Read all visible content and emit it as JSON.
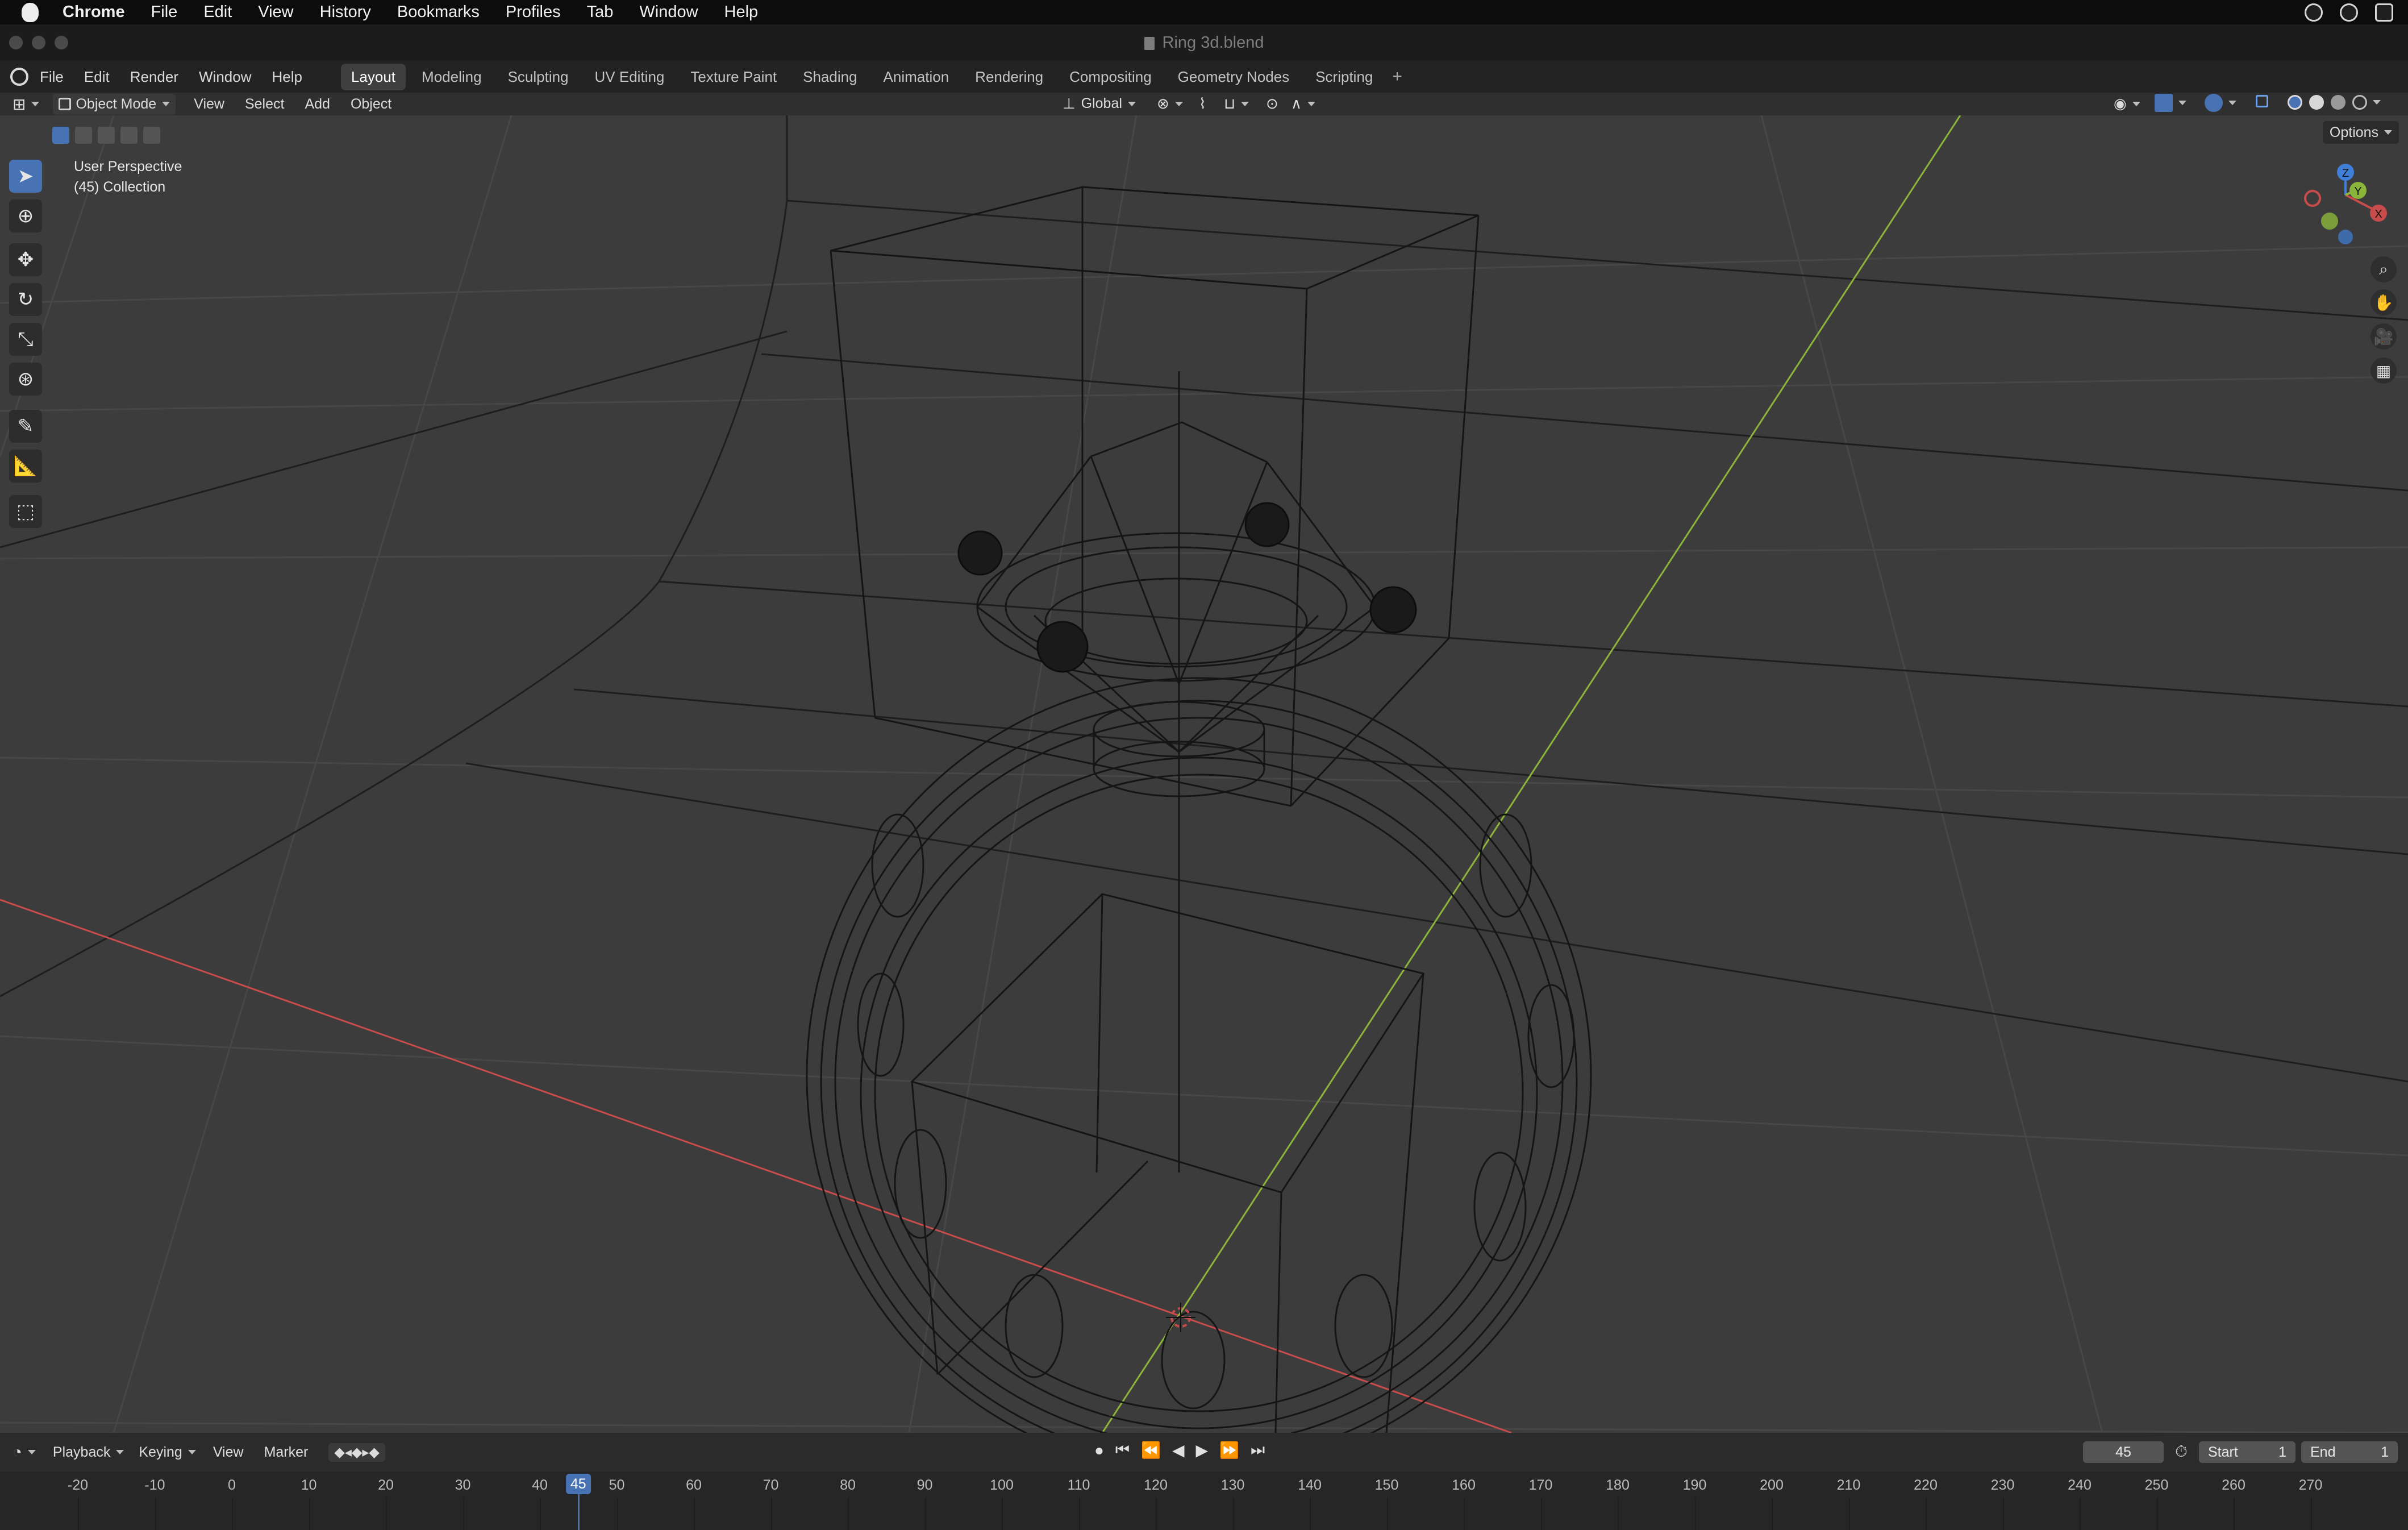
{
  "macos": {
    "menu": [
      "Chrome",
      "File",
      "Edit",
      "View",
      "History",
      "Bookmarks",
      "Profiles",
      "Tab",
      "Window",
      "Help"
    ]
  },
  "window": {
    "title": "Ring 3d.blend"
  },
  "blender": {
    "menu": [
      "File",
      "Edit",
      "Render",
      "Window",
      "Help"
    ],
    "workspaces": [
      "Layout",
      "Modeling",
      "Sculpting",
      "UV Editing",
      "Texture Paint",
      "Shading",
      "Animation",
      "Rendering",
      "Compositing",
      "Geometry Nodes",
      "Scripting"
    ],
    "active_workspace": "Layout"
  },
  "viewport_header": {
    "mode": "Object Mode",
    "menus": [
      "View",
      "Select",
      "Add",
      "Object"
    ],
    "orientation": "Global",
    "options_label": "Options"
  },
  "viewport": {
    "perspective": "User Perspective",
    "collection": "(45) Collection",
    "gizmo_axes": {
      "z": "Z",
      "y": "Y",
      "x": "X"
    },
    "colors": {
      "x_axis": "#c94c4c",
      "y_axis": "#8bb53a",
      "z_axis": "#3f7fd8",
      "background": "#3c3c3c",
      "wire": "#151515",
      "grid": "#474747"
    }
  },
  "timeline": {
    "menus": [
      "Playback",
      "Keying",
      "View",
      "Marker"
    ],
    "current_frame": "45",
    "start_label": "Start",
    "start_value": "1",
    "end_label": "End",
    "end_value": "1",
    "ruler": [
      "-20",
      "-10",
      "0",
      "10",
      "20",
      "30",
      "40",
      "50",
      "60",
      "70",
      "80",
      "90",
      "100",
      "110",
      "120",
      "130",
      "140",
      "150",
      "160",
      "170",
      "180",
      "190",
      "200",
      "210",
      "220",
      "230",
      "240",
      "250",
      "260",
      "270"
    ],
    "highlight": "45"
  }
}
